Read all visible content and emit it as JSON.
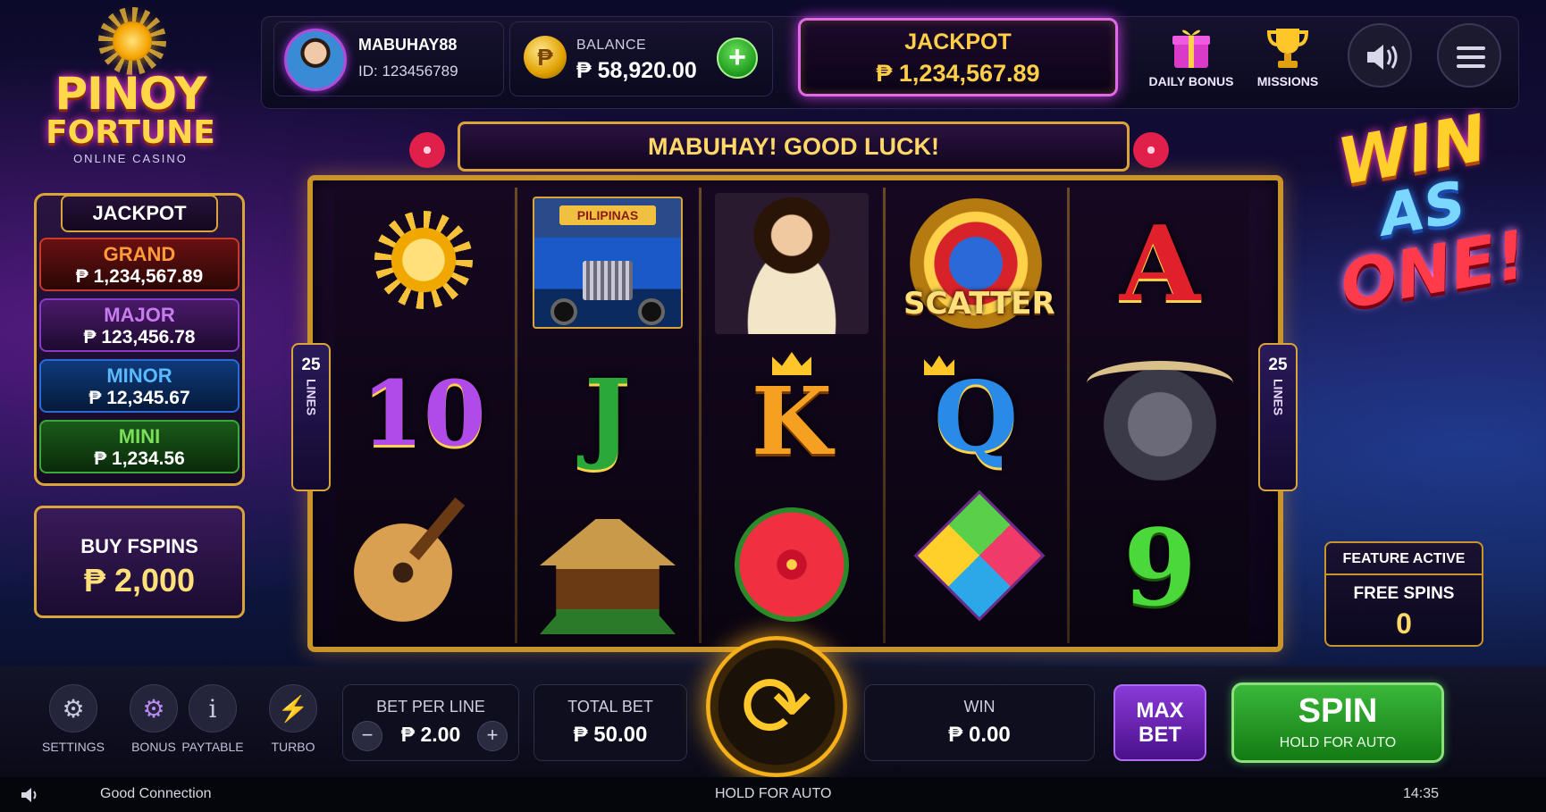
{
  "logo": {
    "line1": "PINOY",
    "line2": "FORTUNE",
    "line3": "ONLINE CASINO"
  },
  "player": {
    "username": "MABUHAY88",
    "id": "ID: 123456789"
  },
  "balance": {
    "label": "BALANCE",
    "value": "₱ 58,920.00",
    "add_icon": "+",
    "coin_glyph": "₱"
  },
  "top_jackpot": {
    "label": "JACKPOT",
    "value": "₱ 1,234,567.89"
  },
  "nav": {
    "daily_bonus": "DAILY BONUS",
    "missions": "MISSIONS"
  },
  "jackpot_panel": {
    "title": "JACKPOT",
    "tiers": [
      {
        "name": "GRAND",
        "value": "₱ 1,234,567.89",
        "color": "#ff9a3a"
      },
      {
        "name": "MAJOR",
        "value": "₱ 123,456.78",
        "color": "#c87af0"
      },
      {
        "name": "MINOR",
        "value": "₱ 12,345.67",
        "color": "#5ab8ff"
      },
      {
        "name": "MINI",
        "value": "₱ 1,234.56",
        "color": "#7ae05a"
      }
    ]
  },
  "buy_spins": {
    "label": "BUY FSPINS",
    "price": "₱ 2,000"
  },
  "banner": "MABUHAY! GOOD LUCK!",
  "paylines": {
    "count": "25",
    "word": "LINES"
  },
  "reels": [
    [
      "sun-symbol",
      "10",
      "guitar-symbol"
    ],
    [
      "jeepney-symbol",
      "J",
      "nipa-hut-symbol"
    ],
    [
      "filipina-symbol",
      "K",
      "hibiscus-symbol"
    ],
    [
      "scatter-symbol",
      "Q",
      "kite-symbol"
    ],
    [
      "A",
      "carabao-symbol",
      "9"
    ]
  ],
  "scatter_label": "SCATTER",
  "jeepney_sign": "PILIPINAS",
  "promo": {
    "line1": "WIN",
    "line2": "AS",
    "line3": "ONE!"
  },
  "feature": {
    "header": "FEATURE ACTIVE",
    "label": "FREE SPINS",
    "count": "0"
  },
  "toolbar": {
    "settings": "SETTINGS",
    "bonus": "BONUS",
    "paytable": "PAYTABLE",
    "turbo": "TURBO"
  },
  "bet_per_line": {
    "label": "BET PER LINE",
    "value": "₱ 2.00",
    "minus": "−",
    "plus": "+"
  },
  "total_bet": {
    "label": "TOTAL BET",
    "value": "₱ 50.00"
  },
  "win": {
    "label": "WIN",
    "value": "₱ 0.00"
  },
  "max_bet": {
    "line1": "MAX",
    "line2": "BET"
  },
  "spin": {
    "label": "SPIN",
    "sub": "HOLD FOR AUTO"
  },
  "status_bar": {
    "connection": "Good Connection",
    "center": "HOLD FOR AUTO",
    "time": "14:35"
  },
  "colors": {
    "gold": "#d9a43a",
    "accent_pink": "#e06ae8",
    "spin_green": "#3ab83a",
    "max_bet_purple": "#8a3ad8"
  }
}
